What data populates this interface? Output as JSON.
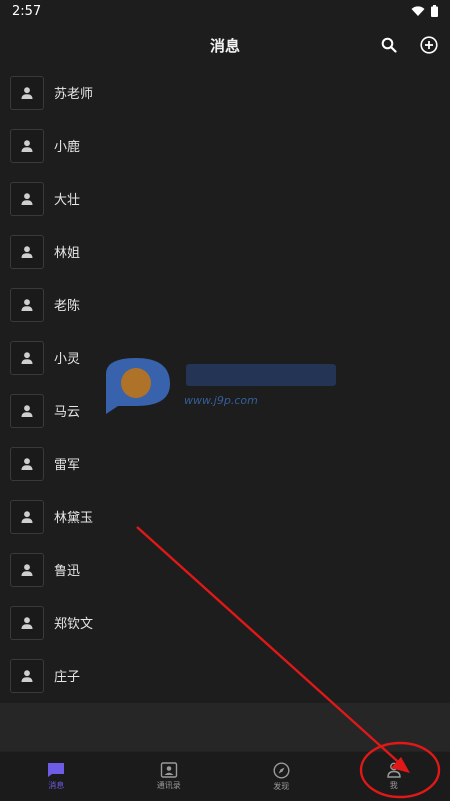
{
  "status_bar": {
    "time": "2:57"
  },
  "header": {
    "title": "消息"
  },
  "contacts": [
    {
      "name": "苏老师"
    },
    {
      "name": "小鹿"
    },
    {
      "name": "大壮"
    },
    {
      "name": "林姐"
    },
    {
      "name": "老陈"
    },
    {
      "name": "小灵"
    },
    {
      "name": "马云"
    },
    {
      "name": "雷军"
    },
    {
      "name": "林黛玉"
    },
    {
      "name": "鲁迅"
    },
    {
      "name": "郑钦文"
    },
    {
      "name": "庄子"
    }
  ],
  "bottom_nav": [
    {
      "label": "消息",
      "icon": "chat-icon",
      "active": true
    },
    {
      "label": "通讯录",
      "icon": "contacts-icon",
      "active": false
    },
    {
      "label": "发现",
      "icon": "compass-icon",
      "active": false
    },
    {
      "label": "我",
      "icon": "person-icon",
      "active": false
    }
  ],
  "watermark": {
    "url": "www.j9p.com"
  },
  "colors": {
    "accent": "#6f5ce6",
    "annotation": "#e01818",
    "background": "#1d1d1d"
  }
}
